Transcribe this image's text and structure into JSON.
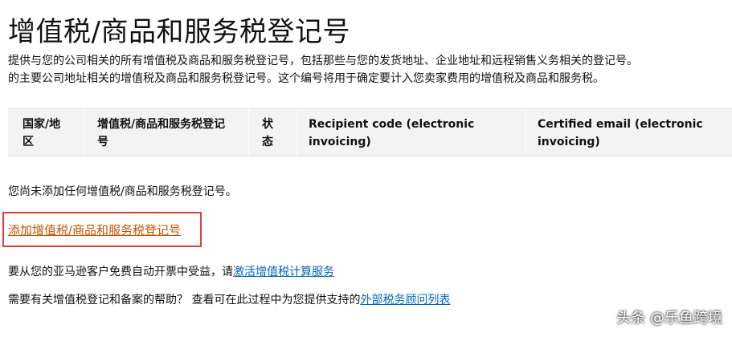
{
  "page": {
    "title": "增值税/商品和服务税登记号",
    "description_line1": "提供与您的公司相关的所有增值税及商品和服务税登记号，包括那些与您的发货地址、企业地址和远程销售义务相关的登记号。",
    "description_line2": "的主要公司地址相关的增值税及商品和服务税登记号。这个编号将用于确定要计入您卖家费用的增值税及商品和服务税。"
  },
  "table": {
    "headers": [
      "国家/地区",
      "增值税/商品和服务税登记号",
      "状态",
      "Recipient code (electronic invoicing)",
      "Certified email (electronic invoicing)"
    ]
  },
  "empty_message": "您尚未添加任何增值税/商品和服务税登记号。",
  "add_link": "添加增值税/商品和服务税登记号",
  "promo": {
    "text": "要从您的亚马逊客户免费自动开票中受益，请",
    "link": "激活增值税计算服务"
  },
  "help": {
    "text": "需要有关增值税登记和备案的帮助？ 查看可在此过程中为您提供支持的",
    "link": "外部税务顾问列表"
  },
  "watermark": "头条 @乐鱼跨境",
  "colors": {
    "link_orange": "#c45500",
    "link_blue": "#0066c0",
    "highlight_box": "#e23b3b",
    "header_bg": "#f3f3f3"
  }
}
